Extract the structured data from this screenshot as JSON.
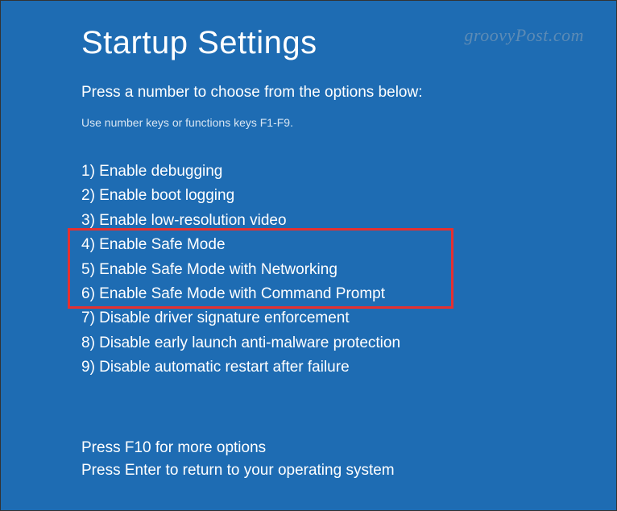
{
  "title": "Startup Settings",
  "instruction": "Press a number to choose from the options below:",
  "hint": "Use number keys or functions keys F1-F9.",
  "options": [
    "1) Enable debugging",
    "2) Enable boot logging",
    "3) Enable low-resolution video",
    "4) Enable Safe Mode",
    "5) Enable Safe Mode with Networking",
    "6) Enable Safe Mode with Command Prompt",
    "7) Disable driver signature enforcement",
    "8) Disable early launch anti-malware protection",
    "9) Disable automatic restart after failure"
  ],
  "footer": {
    "more": "Press F10 for more options",
    "return": "Press Enter to return to your operating system"
  },
  "watermark": "groovyPost.com"
}
